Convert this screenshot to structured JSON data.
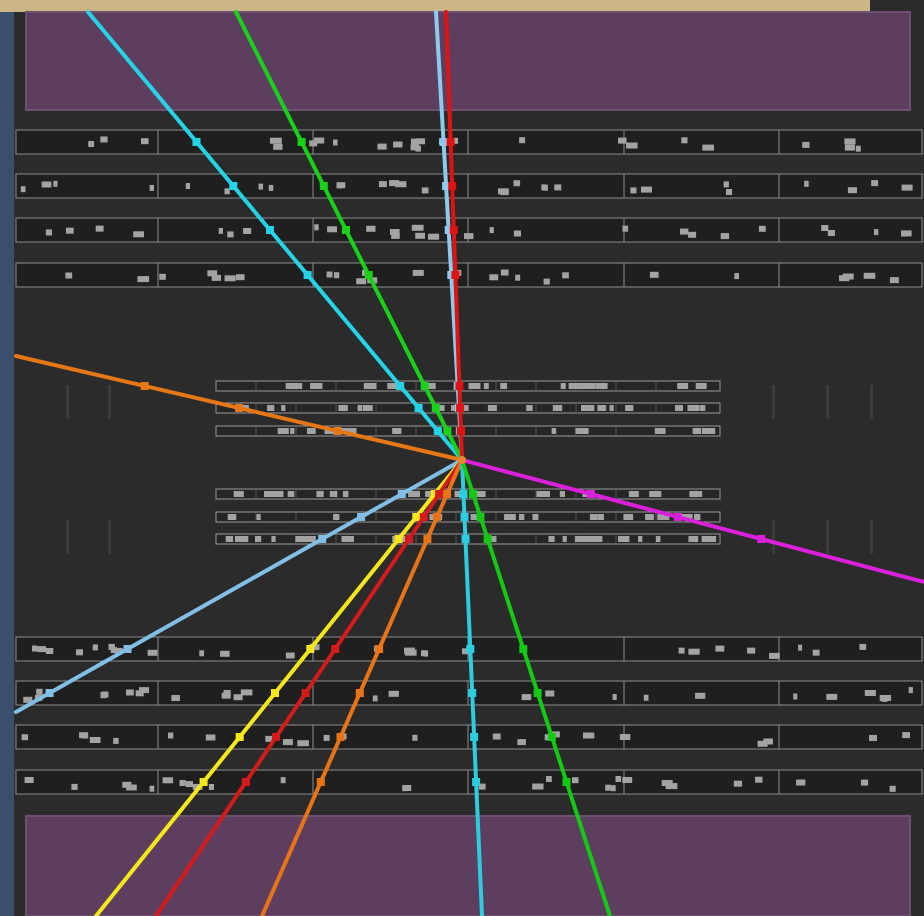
{
  "scene": {
    "kind": "particle-detector-event-display",
    "colors": {
      "background": "#2b2b2b",
      "top_band": "#cdb685",
      "left_edge": "#3a4f6e",
      "calorimeter": "#5e3e5f",
      "calorimeter_border": "#6e5170",
      "muon_chamber_fill": "#1f1f1f",
      "muon_chamber_border": "#8c8c8c",
      "inner_tracker_border": "#9a9a9a",
      "hit_gray": "#a3a3a3",
      "vertex": "#e8882a"
    },
    "tracks": [
      {
        "id": "track-1",
        "color": "#25d3e6"
      },
      {
        "id": "track-2",
        "color": "#19d119"
      },
      {
        "id": "track-3",
        "color": "#8ec9ee"
      },
      {
        "id": "track-4",
        "color": "#e01313"
      },
      {
        "id": "track-5",
        "color": "#e67716"
      },
      {
        "id": "track-6",
        "color": "#da20da"
      },
      {
        "id": "track-7",
        "color": "#82bfe6"
      },
      {
        "id": "track-8",
        "color": "#f4e81d"
      },
      {
        "id": "track-9",
        "color": "#d41a1a"
      },
      {
        "id": "track-10",
        "color": "#e87417"
      },
      {
        "id": "track-11",
        "color": "#2ccde0"
      },
      {
        "id": "track-12",
        "color": "#14c914"
      }
    ]
  }
}
